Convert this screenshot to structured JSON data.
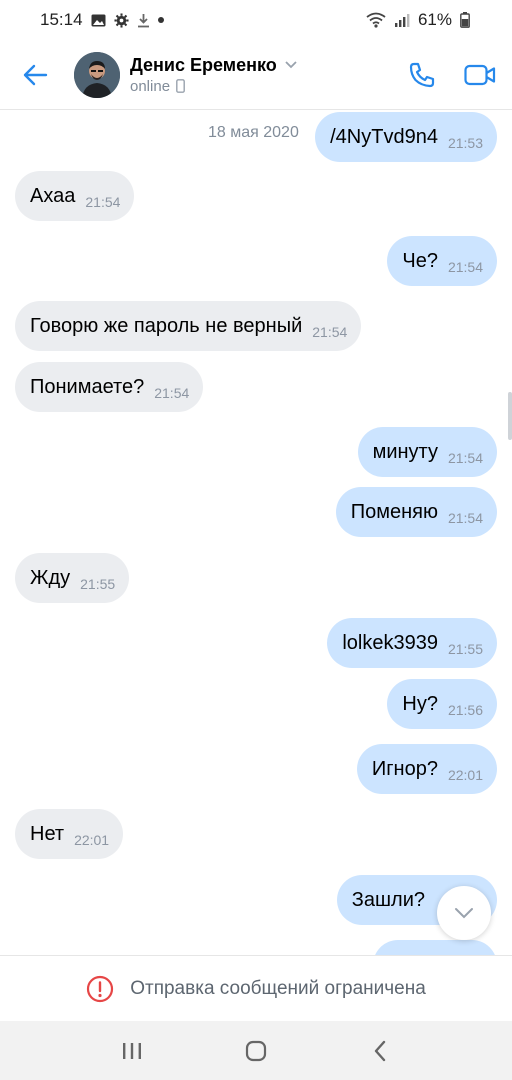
{
  "status_bar": {
    "time": "15:14",
    "battery": "61%"
  },
  "header": {
    "contact_name": "Денис Еременко",
    "contact_status": "online"
  },
  "chat": {
    "date_label": "18 мая 2020",
    "messages": [
      {
        "direction": "out",
        "text": "/4NyTvd9n4",
        "time": "21:53"
      },
      {
        "direction": "in",
        "text": "Ахаа",
        "time": "21:54"
      },
      {
        "direction": "out",
        "text": "Че?",
        "time": "21:54"
      },
      {
        "direction": "in",
        "text": "Говорю же пароль не верный",
        "time": "21:54"
      },
      {
        "direction": "in",
        "text": "Понимаете?",
        "time": "21:54"
      },
      {
        "direction": "out",
        "text": "минуту",
        "time": "21:54"
      },
      {
        "direction": "out",
        "text": "Поменяю",
        "time": "21:54"
      },
      {
        "direction": "in",
        "text": "Жду",
        "time": "21:55"
      },
      {
        "direction": "out",
        "text": "lolkek3939",
        "time": "21:55"
      },
      {
        "direction": "out",
        "text": "Ну?",
        "time": "21:56"
      },
      {
        "direction": "out",
        "text": "Игнор?",
        "time": "22:01"
      },
      {
        "direction": "in",
        "text": "Нет",
        "time": "22:01"
      },
      {
        "direction": "out",
        "text": "Зашли?",
        "time": ""
      }
    ]
  },
  "notice": {
    "text": "Отправка сообщений ограничена"
  },
  "colors": {
    "accent": "#2688eb",
    "incoming_bubble": "#ebedf0",
    "outgoing_bubble": "#cce4ff",
    "warning": "#e64646"
  },
  "icons": {
    "back": "arrow-left-icon",
    "call": "phone-icon",
    "video": "video-camera-icon",
    "scroll_down": "chevron-down-icon",
    "notice": "exclamation-circle-icon",
    "nav_recent": "recent-apps-icon",
    "nav_home": "home-icon",
    "nav_back": "nav-back-icon"
  }
}
